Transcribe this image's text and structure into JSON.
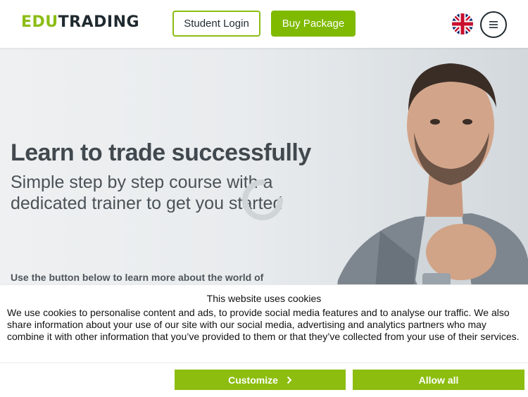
{
  "header": {
    "logo_edu": "EDU",
    "logo_trading": "TRADING",
    "student_login_label": "Student Login",
    "buy_package_label": "Buy Package",
    "language_icon": "uk-flag-icon",
    "menu_icon": "hamburger-menu-icon"
  },
  "hero": {
    "title": "Learn to trade successfully",
    "subtitle": "Simple step by step course with a dedicated trainer to get you started",
    "text": "Use the button below to learn more about the world of"
  },
  "cookie_banner": {
    "title": "This website uses cookies",
    "body": "We use cookies to personalise content and ads, to provide social media features and to analyse our traffic. We also share information about your use of our site with our social media, advertising and analytics partners who may combine it with other information that you’ve provided to them or that they’ve collected from your use of their services.",
    "customize_label": "Customize",
    "allow_all_label": "Allow all"
  },
  "colors": {
    "brand_green": "#8bbd15",
    "dark_text": "#1f2a30",
    "cookie_button": "#8cbd0f"
  }
}
